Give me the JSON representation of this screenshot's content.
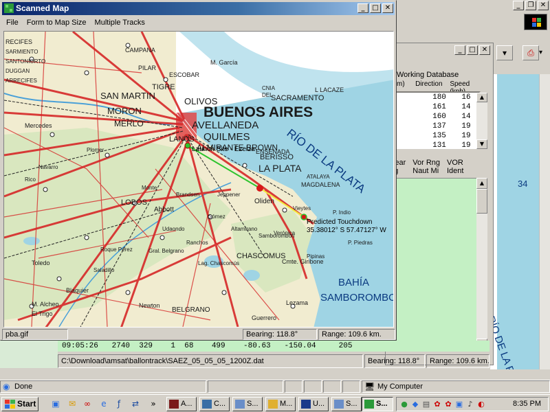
{
  "map_window": {
    "title": "Scanned Map",
    "menu": [
      "File",
      "Form to Map Size",
      "Multiple Tracks"
    ],
    "status": {
      "file": "pba.gif",
      "bearing": "Bearing: 118.8°",
      "range": "Range: 109.6 km."
    },
    "map": {
      "launch_label": "Launch Site - Ezeiza",
      "touchdown_label_1": "Predicted Touchdown",
      "touchdown_label_2": "35.38012° S 57.47127° W",
      "place_labels": [
        "RECIFES",
        "CAMPANA",
        "SARMIENTO",
        "SANTONIORTO",
        "DUGGAN",
        "ARRECIFES",
        "PILAR",
        "TIGRE",
        "OLIVOS",
        "BUENOS AIRES",
        "SACRAMENTO",
        "SAN MARTIN",
        "MORON",
        "AVELLANEDA",
        "QUILMES",
        "ALMIRANTE BROWN",
        "MERLO",
        "LANUS",
        "ENSENADA",
        "LA PLATA",
        "BERISSO",
        "RÍO DE LA PLATA",
        "MAGDALENA",
        "ATALAYA",
        "LOBOS",
        "Abbott",
        "Oliden",
        "Vieytes",
        "P. Indio",
        "Verónica",
        "CHASCOMUS",
        "Lag. Chascomús",
        "Cmte. Giribone",
        "BAHÍA",
        "SAMBOROMBON",
        "P. Piedras",
        "Altamirano",
        "M. Alcheo",
        "Guerrero",
        "Lezama",
        "Newton",
        "BELGRANO",
        "CNIA",
        "DEL",
        "SACRAMENTO",
        "L LACAZE",
        "M. García",
        "ESCOBAR",
        "Plomer",
        "Mercedes",
        "Navarro",
        "Brandsen",
        "Ranchos",
        "Udaondo",
        "Jeppener",
        "Gómez",
        "Samborombón",
        "Pipinas",
        "Rico",
        "Blaquier",
        "Toledo",
        "El Trigo",
        "Monte",
        "Gral. Belgrano",
        "Roque Pérez",
        "Saladillo"
      ]
    }
  },
  "track_window": {
    "working_db_label": "Working Database",
    "columns": [
      "m)",
      "Direction",
      "Speed (kph)"
    ],
    "rows": [
      {
        "dir": "180",
        "spd": "16"
      },
      {
        "dir": "161",
        "spd": "14"
      },
      {
        "dir": "160",
        "spd": "14"
      },
      {
        "dir": "137",
        "spd": "19"
      },
      {
        "dir": "135",
        "spd": "19"
      },
      {
        "dir": "131",
        "spd": "19"
      }
    ],
    "vor_cols": [
      {
        "l1": "Bear",
        "l2": "eg"
      },
      {
        "l1": "Vor Rng",
        "l2": "Naut Mi"
      },
      {
        "l1": "VOR",
        "l2": "Ident"
      }
    ],
    "data_row": "09:05:26   2740  329    1  68    499    -80.63   -150.04     205",
    "path": "C:\\Download\\amsat\\ballontrack\\SAEZ_05_05_05_1200Z.dat",
    "bearing": "Bearing: 118.8°",
    "range": "Range: 109.6 km."
  },
  "bigmap": {
    "label_34": "34",
    "label_vertical": "RÍO DE LA PLATA"
  },
  "explorer_status": {
    "done": "Done",
    "zone": "My Computer"
  },
  "taskbar": {
    "start": "Start",
    "tasks": [
      "A...",
      "C...",
      "S...",
      "M...",
      "U...",
      "S..."
    ],
    "clock": "8:35 PM"
  },
  "colors": {
    "titlebar": "#0a246a",
    "track_green": "#2ec42e",
    "route_yellow": "#f2ea3c",
    "marker_red": "#d81818",
    "sea": "#9fd4e4"
  }
}
